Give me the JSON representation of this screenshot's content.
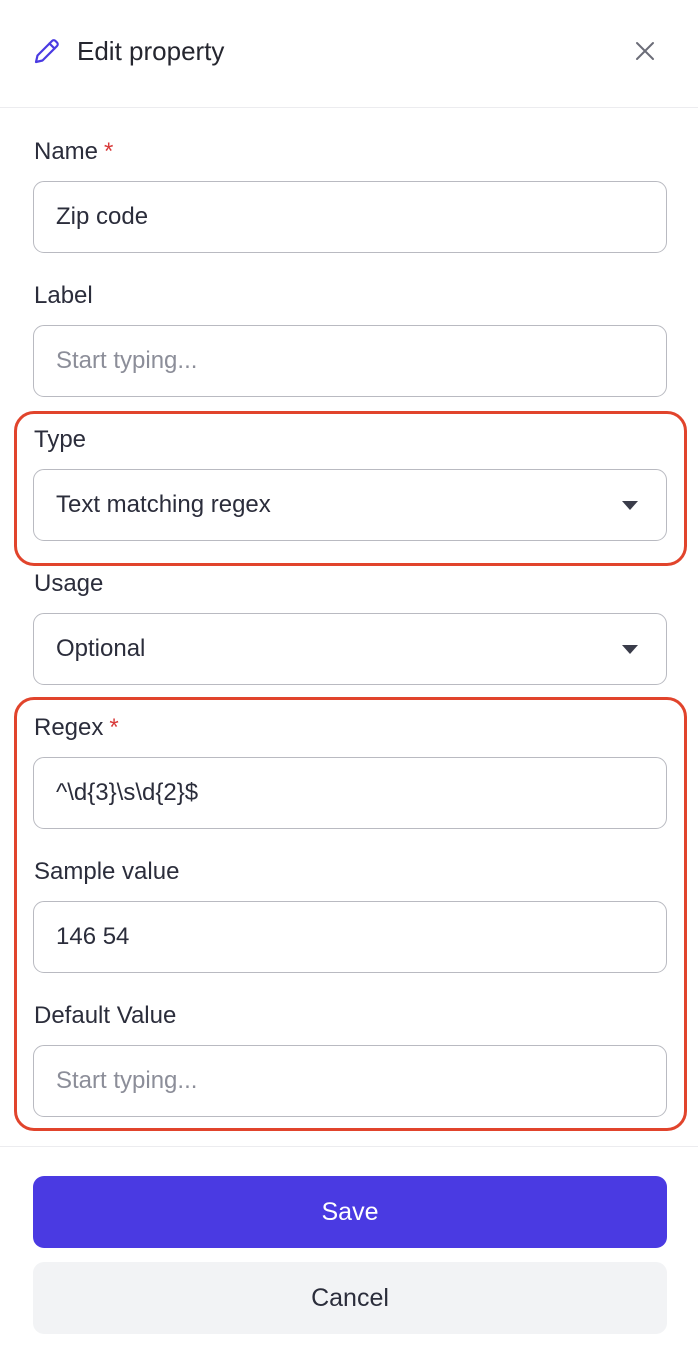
{
  "header": {
    "title": "Edit property",
    "icon": "pencil-icon",
    "close_icon": "close-icon"
  },
  "fields": {
    "name": {
      "label": "Name",
      "required_mark": "*",
      "value": "Zip code"
    },
    "label": {
      "label": "Label",
      "placeholder": "Start typing..."
    },
    "type": {
      "label": "Type",
      "value": "Text matching regex"
    },
    "usage": {
      "label": "Usage",
      "value": "Optional"
    },
    "regex": {
      "label": "Regex",
      "required_mark": "*",
      "value": "^\\d{3}\\s\\d{2}$"
    },
    "sample": {
      "label": "Sample value",
      "value": "146 54"
    },
    "default": {
      "label": "Default Value",
      "placeholder": "Start typing..."
    }
  },
  "actions": {
    "save_label": "Save",
    "cancel_label": "Cancel"
  },
  "colors": {
    "accent": "#4a3ae2",
    "highlight": "#e1442c",
    "required": "#d83a3a"
  }
}
